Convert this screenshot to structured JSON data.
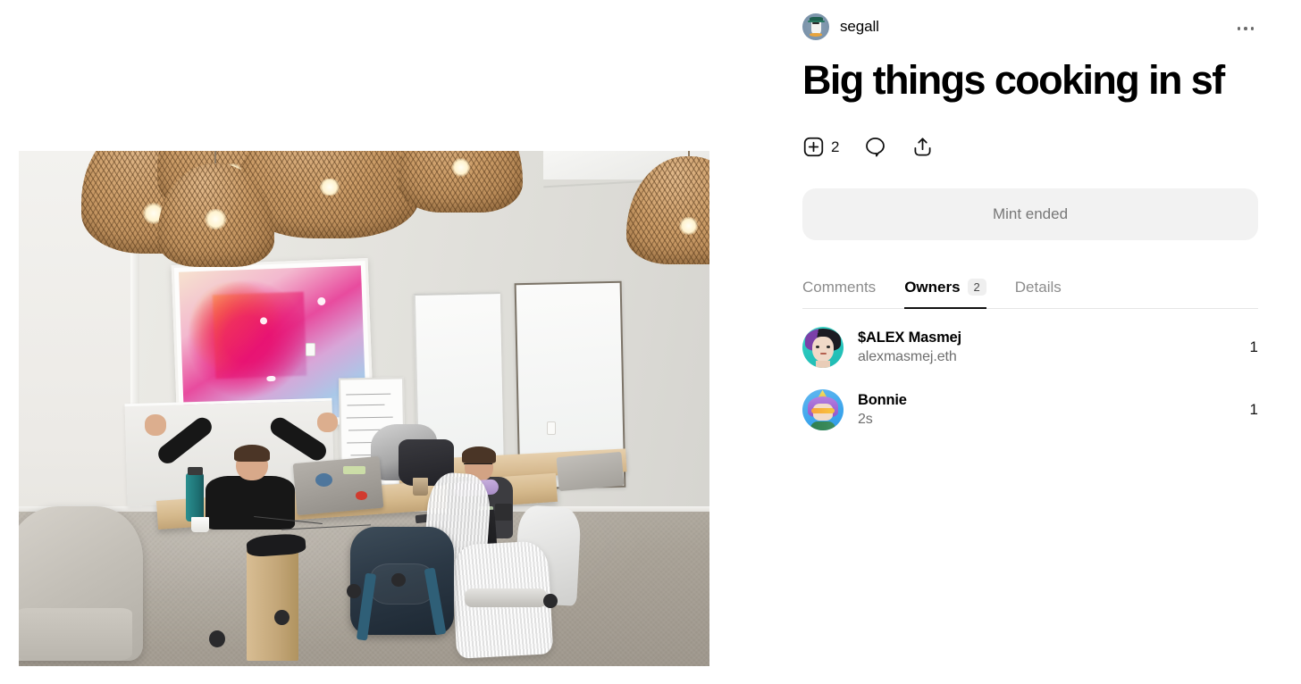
{
  "author": {
    "name": "segall",
    "avatar_icon": "pixel-penguin-avatar",
    "avatar_bg": "#7b93aa"
  },
  "header": {
    "more_menu_icon": "ellipsis-horizontal-icon"
  },
  "post": {
    "title": "Big things cooking in sf",
    "media_alt": "office-photo"
  },
  "actions": {
    "collect": {
      "icon": "plus-square-icon",
      "count": "2"
    },
    "comment": {
      "icon": "comment-bubble-icon"
    },
    "share": {
      "icon": "share-upload-icon"
    }
  },
  "mint": {
    "label": "Mint ended",
    "background": "#f2f2f2",
    "text_color": "#777777"
  },
  "tabs": [
    {
      "label": "Comments",
      "active": false,
      "badge": ""
    },
    {
      "label": "Owners",
      "active": true,
      "badge": "2"
    },
    {
      "label": "Details",
      "active": false,
      "badge": ""
    }
  ],
  "owners": [
    {
      "name": "$ALEX Masmej",
      "sub": "alexmasmej.eth",
      "count": "1",
      "avatar_icon": "alex-masmej-avatar",
      "avatar_bg": "#25c4bb"
    },
    {
      "name": "Bonnie",
      "sub": "2s",
      "count": "1",
      "avatar_icon": "bonnie-avatar",
      "avatar_bg": "#3ea6ec"
    }
  ],
  "colors": {
    "text_primary": "#000000",
    "text_secondary": "#6e6e6e",
    "tab_inactive": "#8c8c8c",
    "divider": "#e6e6e6",
    "badge_bg": "#efefef"
  }
}
